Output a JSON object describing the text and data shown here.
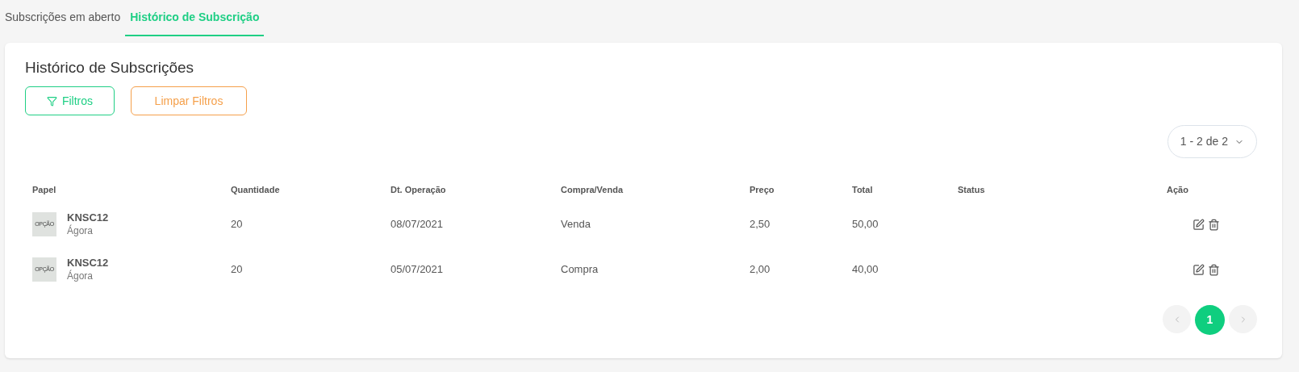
{
  "tabs": [
    {
      "label": "Subscrições em aberto",
      "selected": false
    },
    {
      "label": "Histórico de Subscrição",
      "selected": true
    }
  ],
  "card": {
    "title": "Histórico de Subscrições",
    "filter_button": "Filtros",
    "clear_button": "Limpar Filtros",
    "page_size": "1 - 2 de 2"
  },
  "table": {
    "columns": [
      "Papel",
      "Quantidade",
      "Dt. Operação",
      "Compra/Venda",
      "Preço",
      "Total",
      "Status",
      "Ação"
    ],
    "rows": [
      {
        "logo": "OPÇÃO",
        "ticker": "KNSC12",
        "broker": "Ágora",
        "quantity": "20",
        "date": "08/07/2021",
        "side": "Venda",
        "price": "2,50",
        "total": "50,00"
      },
      {
        "logo": "OPÇÃO",
        "ticker": "KNSC12",
        "broker": "Ágora",
        "quantity": "20",
        "date": "05/07/2021",
        "side": "Compra",
        "price": "2,00",
        "total": "40,00"
      }
    ]
  },
  "pagination": {
    "pages": [
      {
        "label": "1",
        "selected": true
      }
    ]
  }
}
